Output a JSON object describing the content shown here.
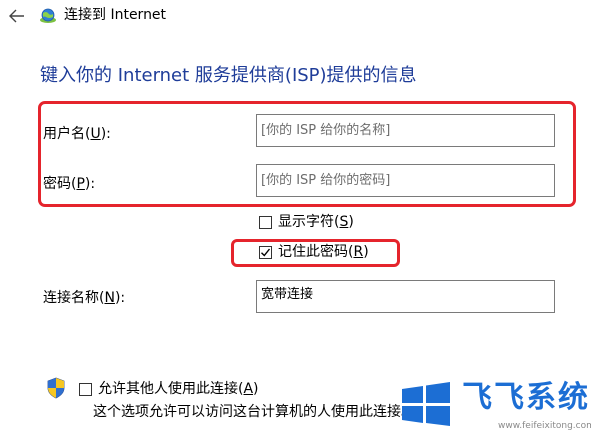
{
  "window": {
    "title": "连接到 Internet"
  },
  "page": {
    "heading": "键入你的 Internet 服务提供商(ISP)提供的信息"
  },
  "form": {
    "username": {
      "label_prefix": "用户名(",
      "accesskey": "U",
      "label_suffix": "):",
      "placeholder": "[你的 ISP 给你的名称]",
      "value": ""
    },
    "password": {
      "label_prefix": "密码(",
      "accesskey": "P",
      "label_suffix": "):",
      "placeholder": "[你的 ISP 给你的密码]",
      "value": ""
    },
    "show_chars": {
      "label_prefix": "显示字符(",
      "accesskey": "S",
      "label_suffix": ")",
      "checked": false
    },
    "remember_password": {
      "label_prefix": "记住此密码(",
      "accesskey": "R",
      "label_suffix": ")",
      "checked": true
    },
    "connection_name": {
      "label_prefix": "连接名称(",
      "accesskey": "N",
      "label_suffix": "):",
      "value": "宽带连接"
    },
    "allow_others": {
      "label_prefix": "允许其他人使用此连接(",
      "accesskey": "A",
      "label_suffix": ")",
      "checked": false,
      "description": "这个选项允许可以访问这台计算机的人使用此连接。"
    }
  },
  "icons": {
    "back": "back-arrow-icon",
    "title": "network-globe-icon",
    "uac": "uac-shield-icon"
  },
  "watermark": {
    "brand": "飞飞系统",
    "url": "www.feifeixitong.com"
  },
  "colors": {
    "heading": "#1f3d99",
    "annotation": "#e5242c",
    "watermark": "#1c6ed4"
  }
}
